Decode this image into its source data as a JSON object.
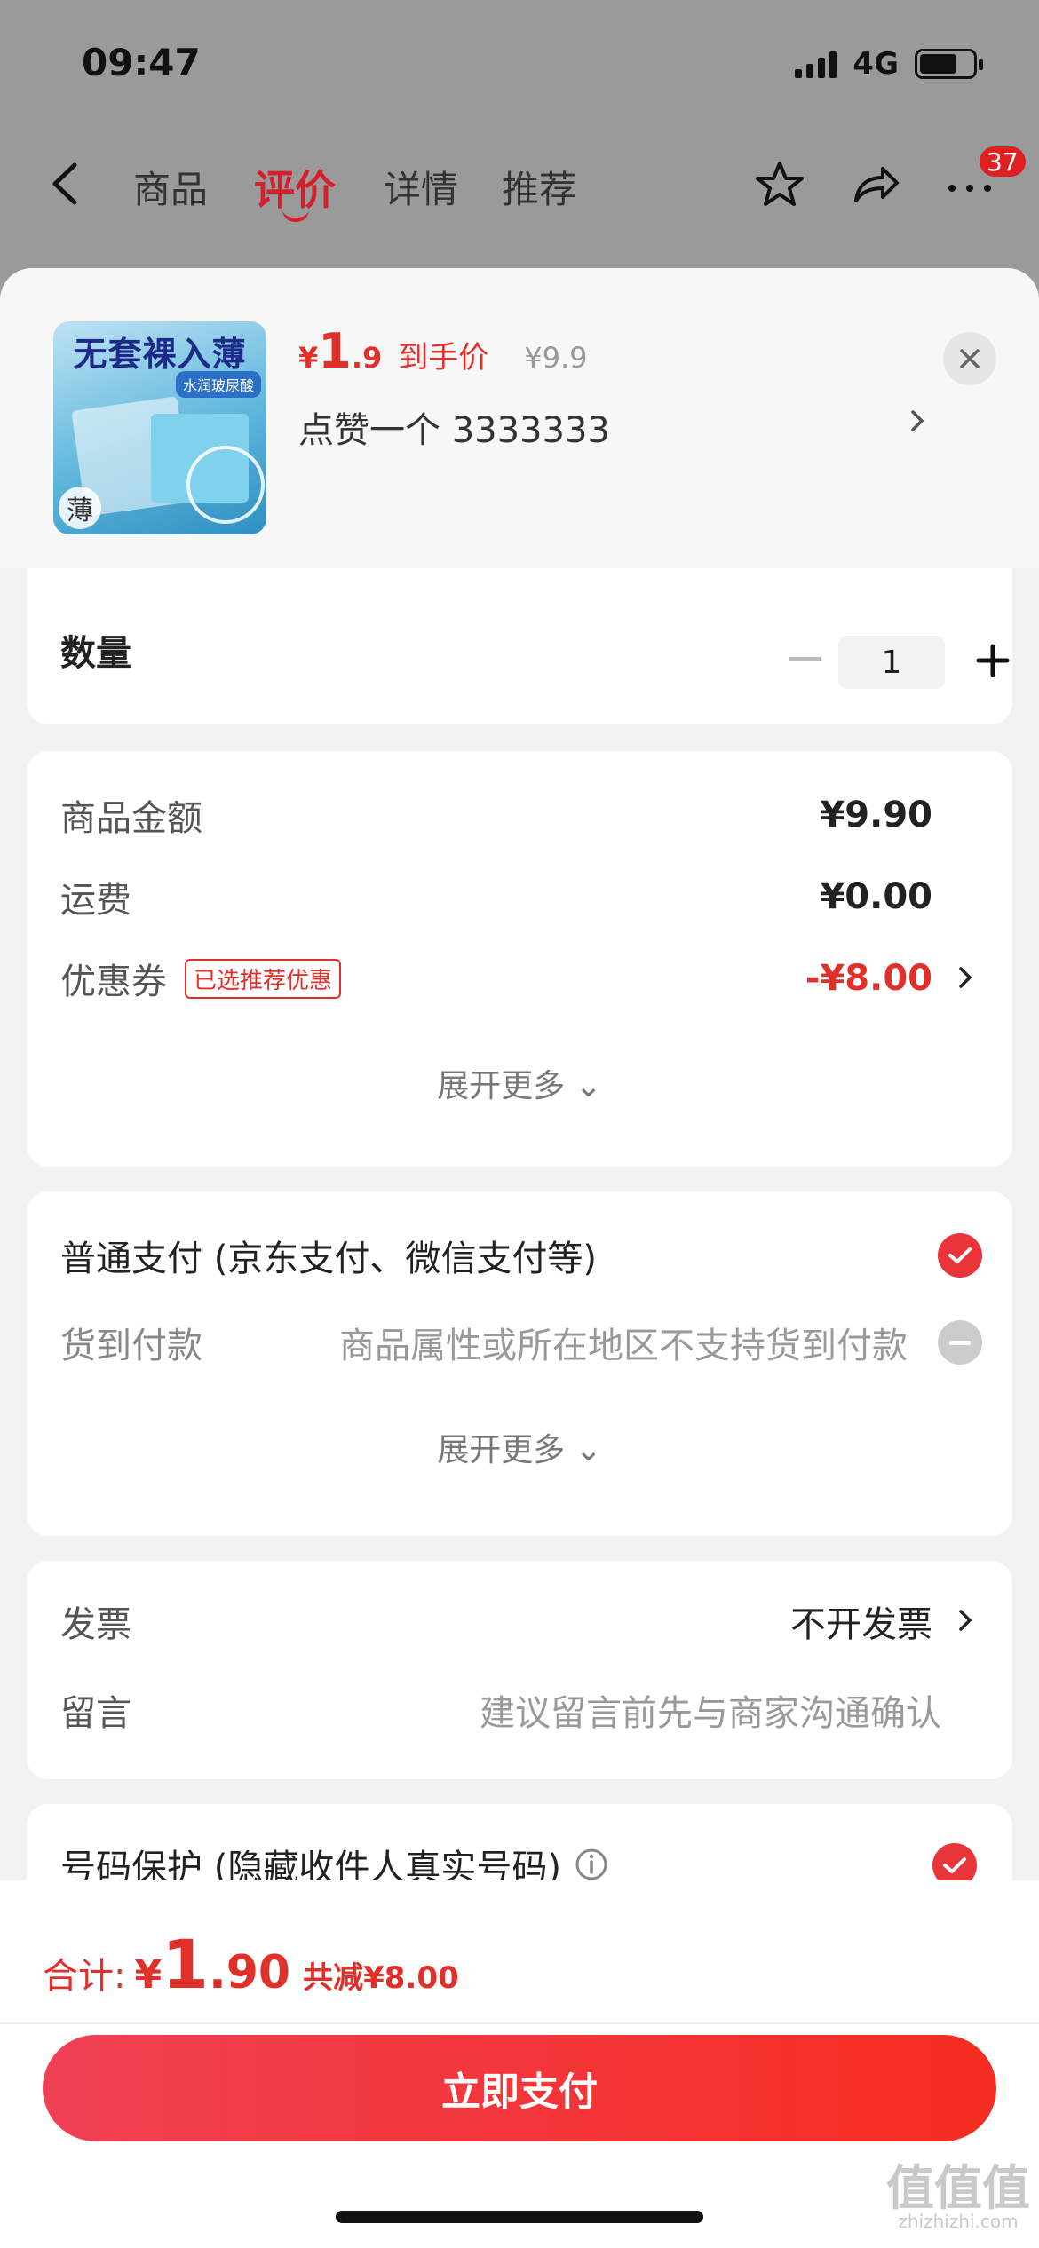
{
  "status_bar": {
    "time": "09:47",
    "network": "4G"
  },
  "nav": {
    "tabs": [
      {
        "label": "商品"
      },
      {
        "label": "评价"
      },
      {
        "label": "详情"
      },
      {
        "label": "推荐"
      }
    ],
    "badge_count": "37"
  },
  "product": {
    "thumb_title": "无套裸入薄",
    "thumb_tag": "水润玻尿酸",
    "thumb_corner": "薄",
    "price_symbol": "¥",
    "price_int": "1",
    "price_dec": ".9",
    "price_label": "到手价",
    "original_price": "¥9.9",
    "spec": "点赞一个  3333333"
  },
  "quantity": {
    "label": "数量",
    "value": "1"
  },
  "summary": {
    "goods_label": "商品金额",
    "goods_value": "¥9.90",
    "shipping_label": "运费",
    "shipping_value": "¥0.00",
    "coupon_label": "优惠券",
    "coupon_tag": "已选推荐优惠",
    "coupon_value": "-¥8.00",
    "expand": "展开更多 ⌄"
  },
  "payment": {
    "normal_label": "普通支付 (京东支付、微信支付等)",
    "cod_label": "货到付款",
    "cod_note": "商品属性或所在地区不支持货到付款",
    "expand": "展开更多 ⌄"
  },
  "extras": {
    "invoice_label": "发票",
    "invoice_value": "不开发票",
    "message_label": "留言",
    "message_placeholder": "建议留言前先与商家沟通确认",
    "privacy_label": "号码保护 (隐藏收件人真实号码)"
  },
  "footer": {
    "total_label": "合计:",
    "total_symbol": "¥",
    "total_int": "1",
    "total_dec": ".90",
    "total_save": "共减¥8.00",
    "pay_label": "立即支付"
  },
  "watermark": {
    "main": "值值值",
    "sub": "zhizhizhi.com"
  },
  "colors": {
    "accent": "#e0302a",
    "button_start": "#ef4054",
    "button_end": "#f72c21"
  }
}
